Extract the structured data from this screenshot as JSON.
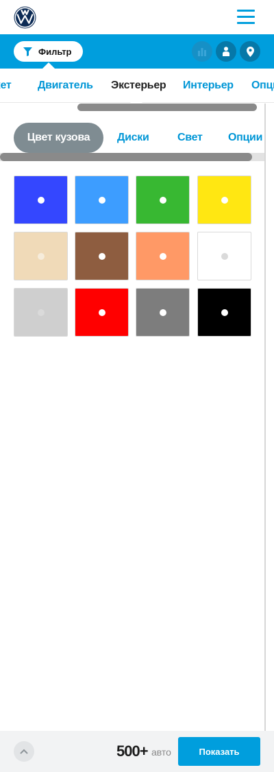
{
  "header": {
    "logo": "vw-logo",
    "menu_icon": "hamburger-icon"
  },
  "filter_bar": {
    "filter_label": "Фильтр",
    "filter_icon": "funnel-icon",
    "buttons": [
      "chart-icon",
      "person-icon",
      "location-pin-icon"
    ]
  },
  "category_tabs": [
    {
      "label": "Пакет",
      "active": false
    },
    {
      "label": "Двигатель",
      "active": false
    },
    {
      "label": "Экстерьер",
      "active": true
    },
    {
      "label": "Интерьер",
      "active": false
    },
    {
      "label": "Опции",
      "active": false
    }
  ],
  "sub_tabs": [
    {
      "label": "Цвет кузова",
      "active": true
    },
    {
      "label": "Диски",
      "active": false
    },
    {
      "label": "Свет",
      "active": false
    },
    {
      "label": "Опции",
      "active": false
    }
  ],
  "colors": [
    "#3447ff",
    "#3d9dff",
    "#38b832",
    "#ffe712",
    "#f0dab8",
    "#8e5d40",
    "#ff9966",
    "#ffffff",
    "#cfcfcf",
    "#ff0000",
    "#7d7d7d",
    "#000000"
  ],
  "footer": {
    "count": "500+",
    "count_unit": "авто",
    "show_label": "Показать",
    "up_icon": "chevron-up-icon"
  },
  "accent_color": "#009edd"
}
